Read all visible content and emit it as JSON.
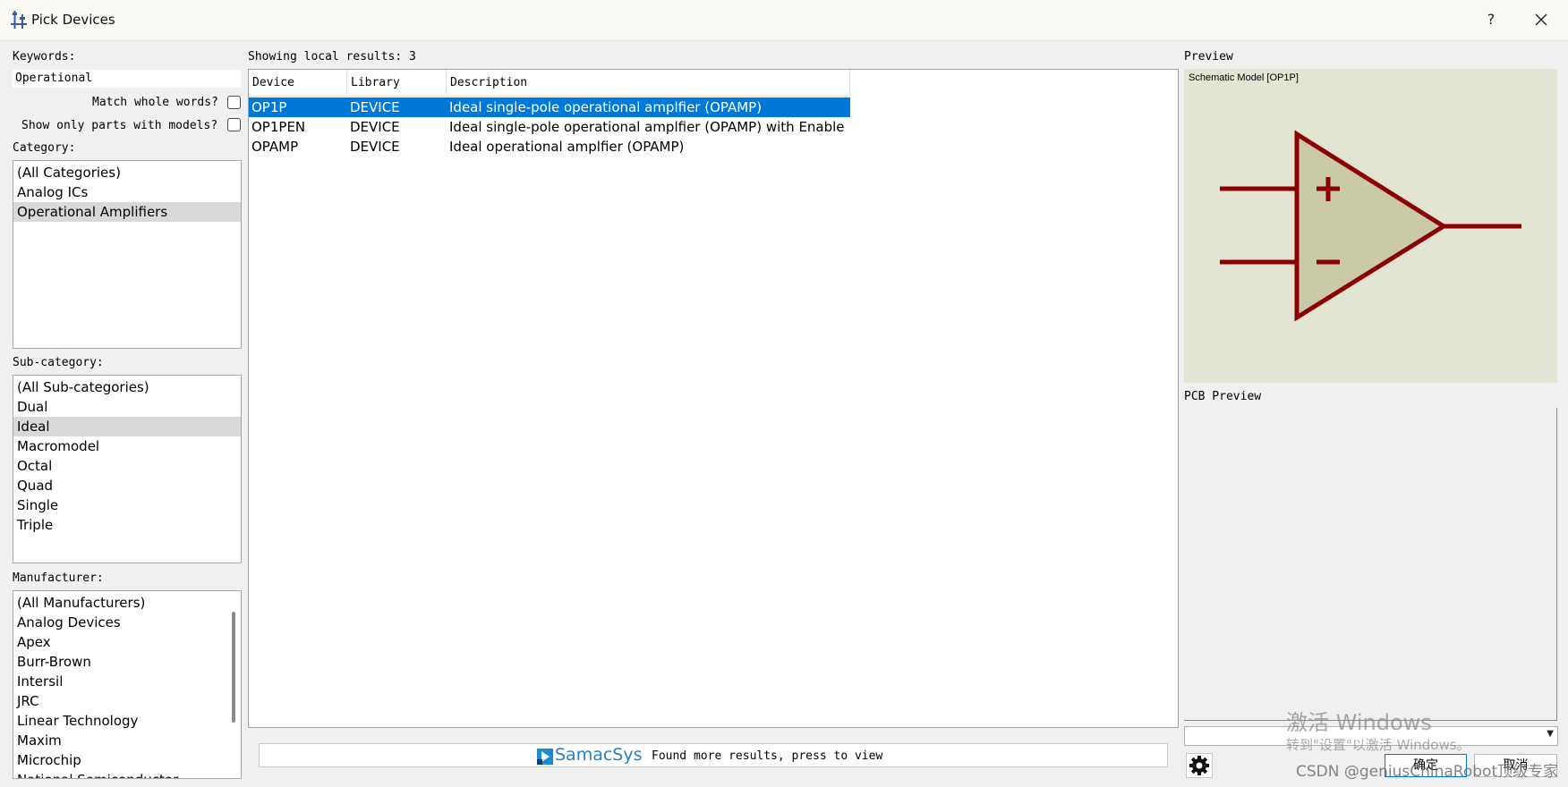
{
  "window": {
    "title": "Pick Devices",
    "help": "?",
    "close": "✕"
  },
  "filters": {
    "keywords_label": "Keywords:",
    "keywords_value": "Operational",
    "match_whole_words": "Match whole words?",
    "show_only_models": "Show only parts with models?",
    "category_label": "Category:",
    "categories": [
      "(All Categories)",
      "Analog ICs",
      "Operational Amplifiers"
    ],
    "subcategory_label": "Sub-category:",
    "subcategories": [
      "(All Sub-categories)",
      "Dual",
      "Ideal",
      "Macromodel",
      "Octal",
      "Quad",
      "Single",
      "Triple"
    ],
    "manufacturer_label": "Manufacturer:",
    "manufacturers": [
      "(All Manufacturers)",
      "Analog Devices",
      "Apex",
      "Burr-Brown",
      "Intersil",
      "JRC",
      "Linear Technology",
      "Maxim",
      "Microchip",
      "National Semiconductor"
    ]
  },
  "results": {
    "summary": "Showing local results: 3",
    "columns": [
      "Device",
      "Library",
      "Description"
    ],
    "rows": [
      {
        "device": "OP1P",
        "library": "DEVICE",
        "description": "Ideal single-pole operational amplfier (OPAMP)"
      },
      {
        "device": "OP1PEN",
        "library": "DEVICE",
        "description": "Ideal single-pole operational amplfier (OPAMP) with Enable"
      },
      {
        "device": "OPAMP",
        "library": "DEVICE",
        "description": "Ideal operational amplfier (OPAMP)"
      }
    ]
  },
  "samacsys": {
    "brand": "SamacSys",
    "message": "Found more results, press to view"
  },
  "preview": {
    "label": "Preview",
    "schematic_caption": "Schematic Model [OP1P]",
    "pcb_label": "PCB Preview",
    "symbol_color": "#8b0000",
    "symbol_fill": "#cbcaa8",
    "background": "#e4e4d2"
  },
  "buttons": {
    "ok": "确定",
    "cancel": "取消"
  },
  "overlay": {
    "activate_title": "激活 Windows",
    "activate_hint": "转到\"设置\"以激活 Windows。",
    "csdn": "CSDN @geniusChinaRobot顶级专家"
  },
  "colors": {
    "selection": "#0078d7",
    "list_selection": "#d9d9d9"
  }
}
